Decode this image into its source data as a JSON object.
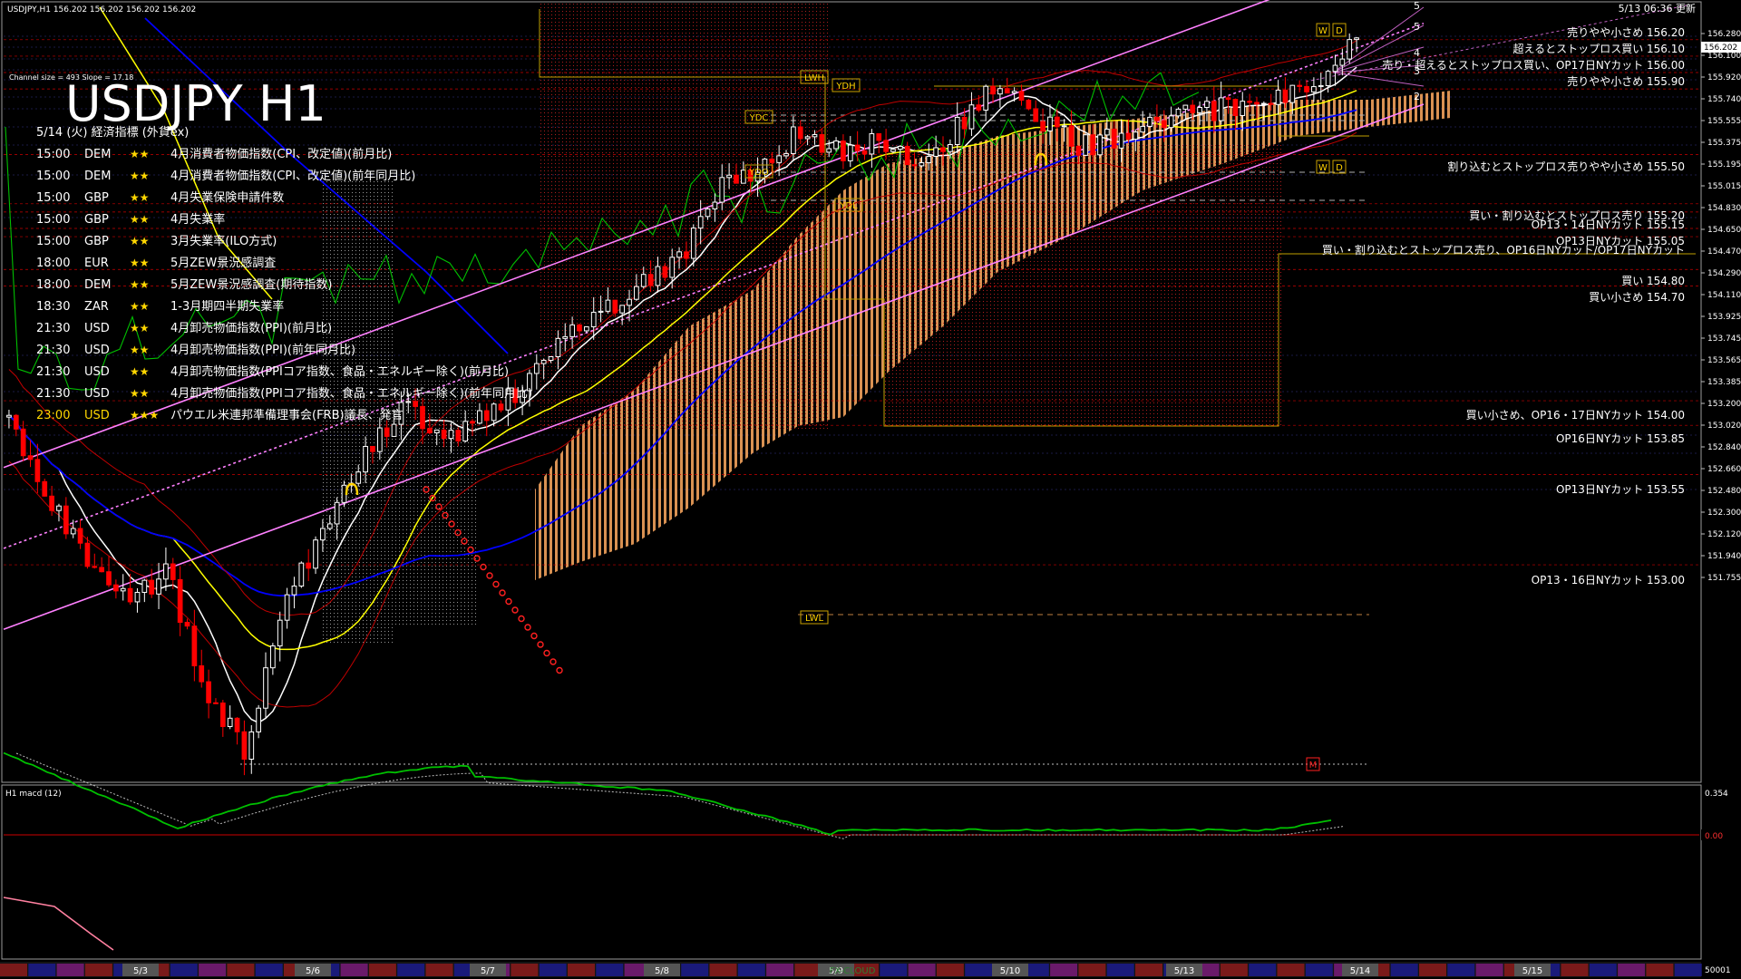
{
  "header": {
    "symbol_line": "USDJPY,H1  156.202 156.202 156.202 156.202",
    "updated": "5/13 06:36 更新",
    "big_title": "USDJPY H1",
    "channel_info": "Channel size = 493 Slope = 17.18",
    "events_title": "5/14 (火) 経済指標 (外貨ex)"
  },
  "events": [
    {
      "time": "15:00",
      "cur": "DEM",
      "stars": "★★",
      "desc": "4月消費者物価指数(CPI、改定値)(前月比)"
    },
    {
      "time": "15:00",
      "cur": "DEM",
      "stars": "★★",
      "desc": "4月消費者物価指数(CPI、改定値)(前年同月比)"
    },
    {
      "time": "15:00",
      "cur": "GBP",
      "stars": "★★",
      "desc": "4月失業保険申請件数"
    },
    {
      "time": "15:00",
      "cur": "GBP",
      "stars": "★★",
      "desc": "4月失業率"
    },
    {
      "time": "15:00",
      "cur": "GBP",
      "stars": "★★",
      "desc": "3月失業率(ILO方式)"
    },
    {
      "time": "18:00",
      "cur": "EUR",
      "stars": "★★",
      "desc": "5月ZEW景況感調査"
    },
    {
      "time": "18:00",
      "cur": "DEM",
      "stars": "★★",
      "desc": "5月ZEW景況感調査(期待指数)"
    },
    {
      "time": "18:30",
      "cur": "ZAR",
      "stars": "★★",
      "desc": "1-3月期四半期失業率"
    },
    {
      "time": "21:30",
      "cur": "USD",
      "stars": "★★",
      "desc": "4月卸売物価指数(PPI)(前月比)"
    },
    {
      "time": "21:30",
      "cur": "USD",
      "stars": "★★",
      "desc": "4月卸売物価指数(PPI)(前年同月比)"
    },
    {
      "time": "21:30",
      "cur": "USD",
      "stars": "★★",
      "desc": "4月卸売物価指数(PPIコア指数、食品・エネルギー除く)(前月比)"
    },
    {
      "time": "21:30",
      "cur": "USD",
      "stars": "★★",
      "desc": "4月卸売物価指数(PPIコア指数、食品・エネルギー除く)(前年同月比)"
    },
    {
      "time": "23:00",
      "cur": "USD",
      "stars": "★★★",
      "desc": "パウエル米連邦準備理事会(FRB)議長、発言"
    }
  ],
  "order_labels": [
    {
      "text": "売りやや小さめ 156.20",
      "price": 156.2
    },
    {
      "text": "超えるとストップロス買い 156.10",
      "price": 156.1
    },
    {
      "text": "売り・超えるとストップロス買い、OP17日NYカット 156.00",
      "price": 156.0
    },
    {
      "text": "売りやや小さめ 155.90",
      "price": 155.9
    },
    {
      "text": "割り込むとストップロス売りやや小さめ 155.50",
      "price": 155.5
    },
    {
      "text": "買い・割り込むとストップロス売り 155.20",
      "price": 155.2
    },
    {
      "text": "OP13・14日NYカット 155.15",
      "price": 155.15
    },
    {
      "text": "OP13日NYカット 155.05",
      "price": 155.05
    },
    {
      "text": "買い・割り込むとストップロス売り、OP16日NYカット/OP17日NYカット",
      "price": 155.0
    },
    {
      "text": "買い 154.80",
      "price": 154.8
    },
    {
      "text": "買い小さめ 154.70",
      "price": 154.7
    },
    {
      "text": "買い小さめ、OP16・17日NYカット 154.00",
      "price": 154.0
    },
    {
      "text": "OP16日NYカット 153.85",
      "price": 153.85
    },
    {
      "text": "OP13日NYカット 153.55",
      "price": 153.55
    },
    {
      "text": "OP13・16日NYカット 153.00",
      "price": 153.0
    }
  ],
  "level_tags": [
    {
      "text": "YDH",
      "price": 155.92
    },
    {
      "text": "LWH",
      "price": 155.98
    },
    {
      "text": "YDC",
      "price": 155.74
    },
    {
      "text": "YDO",
      "price": 155.42
    },
    {
      "text": "YDL",
      "price": 155.23
    },
    {
      "text": "LWL",
      "price": 152.74
    },
    {
      "text": "W",
      "price": 156.2
    },
    {
      "text": "D",
      "price": 156.2
    },
    {
      "text": "W",
      "price": 155.46
    },
    {
      "text": "D",
      "price": 155.46
    },
    {
      "text": "M",
      "price": 151.81
    }
  ],
  "fib_labels": [
    "5",
    "5",
    "4",
    "3",
    "2"
  ],
  "price_axis": {
    "ticks": [
      "156.280",
      "156.100",
      "155.920",
      "155.740",
      "155.555",
      "155.375",
      "155.195",
      "155.015",
      "154.830",
      "154.650",
      "154.470",
      "154.290",
      "154.110",
      "153.925",
      "153.745",
      "153.565",
      "153.385",
      "153.200",
      "153.020",
      "152.840",
      "152.660",
      "152.480",
      "152.300",
      "152.120",
      "151.940",
      "151.755"
    ],
    "current_price": "156.202",
    "max": 156.42,
    "min": 151.68
  },
  "macd": {
    "label": "H1  macd (12)",
    "axis_top": "0.354",
    "axis_zero": "0.00",
    "axis_bottom": "50001"
  },
  "date_axis": {
    "labels": [
      "5/3",
      "5/6",
      "5/7",
      "5/8",
      "5/9",
      "5/10",
      "5/13",
      "5/14",
      "5/15"
    ],
    "watermark": "FX-CLOUD"
  },
  "colors": {
    "background": "#000000",
    "bull_candle": "#ffffff",
    "bear_candle": "#ff0000",
    "channel": "#ff80ff",
    "ma_white": "#ffffff",
    "ma_yellow": "#ffff00",
    "ma_blue": "#0000ff",
    "chikou": "#00c000",
    "kumo": "#ffaa60",
    "macd": "#00c000"
  },
  "chart_data": {
    "type": "candlestick",
    "symbol": "USDJPY",
    "timeframe": "H1",
    "ylim": [
      151.68,
      156.42
    ],
    "x_labels": [
      "5/3",
      "5/6",
      "5/7",
      "5/8",
      "5/9",
      "5/10",
      "5/13",
      "5/14",
      "5/15"
    ],
    "close_path": [
      {
        "date": "5/2 20:00",
        "close": 153.9
      },
      {
        "date": "5/3 01:00",
        "close": 153.4
      },
      {
        "date": "5/3 06:00",
        "close": 153.05
      },
      {
        "date": "5/3 11:00",
        "close": 152.8
      },
      {
        "date": "5/3 15:00",
        "close": 152.95
      },
      {
        "date": "5/3 20:00",
        "close": 152.2
      },
      {
        "date": "5/3 22:00",
        "close": 151.86
      },
      {
        "date": "5/6 03:00",
        "close": 152.8
      },
      {
        "date": "5/6 08:00",
        "close": 153.2
      },
      {
        "date": "5/6 13:00",
        "close": 153.7
      },
      {
        "date": "5/6 18:00",
        "close": 153.95
      },
      {
        "date": "5/6 23:00",
        "close": 153.75
      },
      {
        "date": "5/7 04:00",
        "close": 153.9
      },
      {
        "date": "5/7 09:00",
        "close": 154.1
      },
      {
        "date": "5/7 14:00",
        "close": 154.4
      },
      {
        "date": "5/7 19:00",
        "close": 154.55
      },
      {
        "date": "5/8 00:00",
        "close": 154.7
      },
      {
        "date": "5/8 05:00",
        "close": 154.9
      },
      {
        "date": "5/8 10:00",
        "close": 155.3
      },
      {
        "date": "5/8 15:00",
        "close": 155.45
      },
      {
        "date": "5/8 20:00",
        "close": 155.65
      },
      {
        "date": "5/9 02:00",
        "close": 155.5
      },
      {
        "date": "5/9 07:00",
        "close": 155.6
      },
      {
        "date": "5/9 12:00",
        "close": 155.4
      },
      {
        "date": "5/9 17:00",
        "close": 155.7
      },
      {
        "date": "5/9 22:00",
        "close": 155.95
      },
      {
        "date": "5/10 03:00",
        "close": 155.7
      },
      {
        "date": "5/10 08:00",
        "close": 155.55
      },
      {
        "date": "5/10 13:00",
        "close": 155.6
      },
      {
        "date": "5/10 18:00",
        "close": 155.7
      },
      {
        "date": "5/13 00:00",
        "close": 155.75
      },
      {
        "date": "5/13 05:00",
        "close": 155.8
      },
      {
        "date": "5/13 10:00",
        "close": 155.85
      },
      {
        "date": "5/13 15:00",
        "close": 155.9
      },
      {
        "date": "5/13 20:00",
        "close": 156.2
      }
    ],
    "regression_channel": {
      "start": 153.1,
      "end": 156.3,
      "width": 0.493,
      "slope": 17.18
    },
    "macd_range": [
      -0.45,
      0.354
    ],
    "grid": true
  }
}
